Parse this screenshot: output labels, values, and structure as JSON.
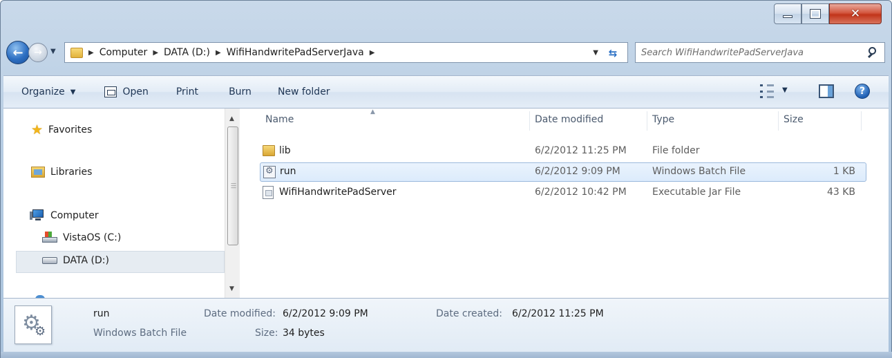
{
  "window": {
    "controls": {
      "minimize": "minimize",
      "maximize": "maximize",
      "close": "close"
    }
  },
  "address": {
    "crumbs": [
      "Computer",
      "DATA (D:)",
      "WifiHandwritePadServerJava"
    ]
  },
  "search": {
    "placeholder": "Search WifiHandwritePadServerJava"
  },
  "toolbar": {
    "organize": "Organize",
    "open": "Open",
    "print": "Print",
    "burn": "Burn",
    "new_folder": "New folder"
  },
  "nav": {
    "favorites": "Favorites",
    "libraries": "Libraries",
    "computer": "Computer",
    "vistaos": "VistaOS (C:)",
    "data": "DATA (D:)"
  },
  "columns": {
    "name": "Name",
    "date": "Date modified",
    "type": "Type",
    "size": "Size"
  },
  "files": [
    {
      "name": "lib",
      "date": "6/2/2012 11:25 PM",
      "type": "File folder",
      "size": "",
      "icon": "folder-icon"
    },
    {
      "name": "run",
      "date": "6/2/2012 9:09 PM",
      "type": "Windows Batch File",
      "size": "1 KB",
      "icon": "batch-file-icon"
    },
    {
      "name": "WifiHandwritePadServer",
      "date": "6/2/2012 10:42 PM",
      "type": "Executable Jar File",
      "size": "43 KB",
      "icon": "jar-file-icon"
    }
  ],
  "details": {
    "name": "run",
    "type": "Windows Batch File",
    "date_modified_label": "Date modified:",
    "date_modified": "6/2/2012 9:09 PM",
    "date_created_label": "Date created:",
    "date_created": "6/2/2012 11:25 PM",
    "size_label": "Size:",
    "size": "34 bytes"
  },
  "colors": {
    "accent": "#2d6fc2",
    "selection": "#dcebfc",
    "close": "#c1341a"
  }
}
